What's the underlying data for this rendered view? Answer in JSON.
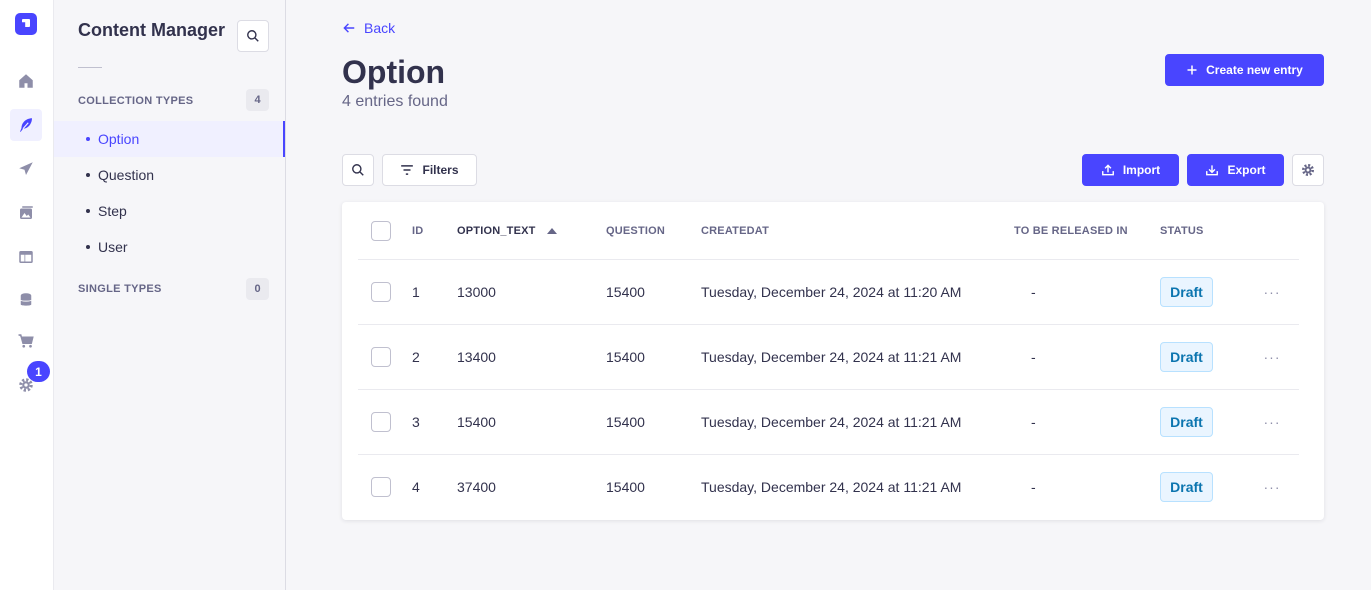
{
  "rail": {
    "items": [
      {
        "icon": "home-icon"
      },
      {
        "icon": "feather-icon",
        "active": true
      },
      {
        "icon": "paper-plane-icon"
      },
      {
        "icon": "images-icon"
      },
      {
        "icon": "layout-icon"
      },
      {
        "icon": "database-icon"
      },
      {
        "icon": "cart-icon"
      },
      {
        "icon": "gear-icon"
      }
    ],
    "notification_count": "1"
  },
  "subnav": {
    "title": "Content Manager",
    "collection_types_label": "COLLECTION TYPES",
    "collection_types_count": "4",
    "collection_types": [
      "Option",
      "Question",
      "Step",
      "User"
    ],
    "single_types_label": "SINGLE TYPES",
    "single_types_count": "0"
  },
  "header": {
    "back_label": "Back",
    "title": "Option",
    "subtitle": "4 entries found",
    "create_label": "Create new entry"
  },
  "toolbar": {
    "filters_label": "Filters",
    "import_label": "Import",
    "export_label": "Export"
  },
  "table": {
    "columns": [
      "ID",
      "OPTION_TEXT",
      "QUESTION",
      "CREATEDAT",
      "TO BE RELEASED IN",
      "STATUS"
    ],
    "rows": [
      {
        "id": "1",
        "option_text": "13000",
        "question": "15400",
        "createdat": "Tuesday, December 24, 2024 at 11:20 AM",
        "release": "-",
        "status": "Draft"
      },
      {
        "id": "2",
        "option_text": "13400",
        "question": "15400",
        "createdat": "Tuesday, December 24, 2024 at 11:21 AM",
        "release": "-",
        "status": "Draft"
      },
      {
        "id": "3",
        "option_text": "15400",
        "question": "15400",
        "createdat": "Tuesday, December 24, 2024 at 11:21 AM",
        "release": "-",
        "status": "Draft"
      },
      {
        "id": "4",
        "option_text": "37400",
        "question": "15400",
        "createdat": "Tuesday, December 24, 2024 at 11:21 AM",
        "release": "-",
        "status": "Draft"
      }
    ]
  },
  "colors": {
    "accent": "#4945ff",
    "draft_text": "#0c75af",
    "draft_bg": "#eaf5ff"
  }
}
